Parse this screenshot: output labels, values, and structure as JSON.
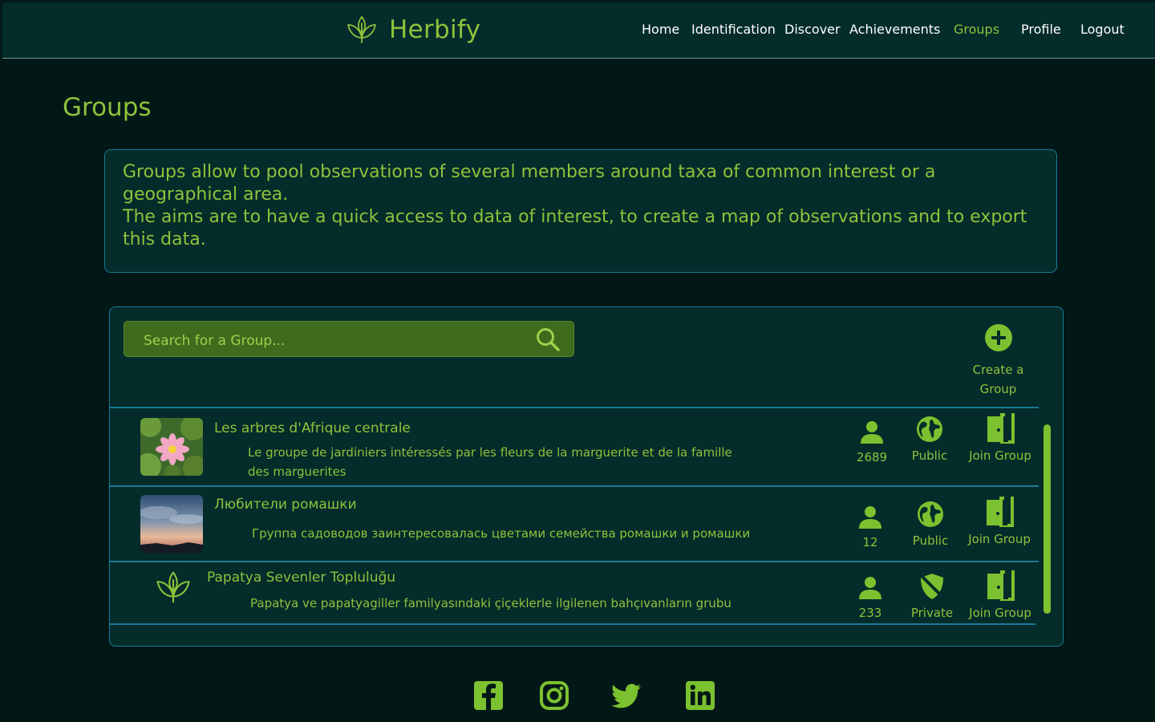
{
  "brand": {
    "name": "Herbify"
  },
  "nav": [
    {
      "label": "Home",
      "active": false
    },
    {
      "label": "Identification",
      "active": false
    },
    {
      "label": "Discover",
      "active": false
    },
    {
      "label": "Achievements",
      "active": false
    },
    {
      "label": "Groups",
      "active": true
    },
    {
      "label": "Profile",
      "active": false
    },
    {
      "label": "Logout",
      "active": false
    }
  ],
  "page": {
    "title": "Groups",
    "intro": [
      "Groups allow to pool observations of several members around taxa of common interest or a geographical area.",
      "The aims are to have a quick access to data of interest, to create a map of observations and to export this data."
    ]
  },
  "search": {
    "placeholder": "Search for a Group..."
  },
  "create": {
    "label": "Create a Group"
  },
  "groups": [
    {
      "name": "Les arbres d'Afrique centrale",
      "description": "Le groupe de jardiniers intéressés par les fleurs de la marguerite et de la famille des marguerites",
      "members": "2689",
      "visibility": "Public",
      "action": "Join Group",
      "image": "water-lily-photo"
    },
    {
      "name": "Любители ромашки",
      "description": "Группа садоводов заинтересовалась цветами семейства ромашки и ромашки",
      "members": "12",
      "visibility": "Public",
      "action": "Join Group",
      "image": "sunset-sky-photo"
    },
    {
      "name": "Papatya Sevenler Topluluğu",
      "description": "Papatya ve papatyagiller familyasındaki çiçeklerle ilgilenen bahçıvanların grubu",
      "members": "233",
      "visibility": "Private",
      "action": "Join Group",
      "image": "leaf-icon"
    }
  ],
  "footer": {
    "social": [
      "facebook-icon",
      "instagram-icon",
      "twitter-icon",
      "linkedin-icon"
    ]
  },
  "colors": {
    "background": "#011816",
    "panel": "#032c2a",
    "accent": "#8fc23c",
    "border": "#1c7a9a",
    "search_bg": "#3f6b1d"
  }
}
